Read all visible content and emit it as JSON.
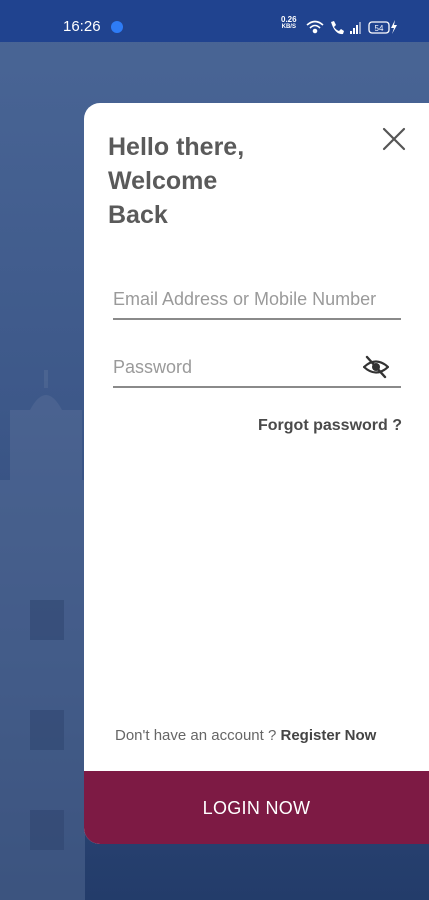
{
  "status_bar": {
    "time": "16:26",
    "net_speed_value": "0.26",
    "net_speed_unit": "KB/S",
    "battery": "54"
  },
  "colors": {
    "status_bar": "#20438f",
    "background": "#3f5a8a",
    "card": "#ffffff",
    "login_button": "#7d1a44"
  },
  "login_card": {
    "greeting_line1": "Hello there,",
    "greeting_line2": "Welcome",
    "greeting_line3": "Back",
    "close_icon": "close-icon",
    "email_placeholder": "Email Address or Mobile Number",
    "email_value": "",
    "password_placeholder": "Password",
    "password_value": "",
    "password_toggle_icon": "eye-off-icon",
    "forgot_password": "Forgot password ?",
    "no_account_text": "Don't have an account ?",
    "register_link": "Register Now",
    "login_button": "LOGIN NOW"
  }
}
